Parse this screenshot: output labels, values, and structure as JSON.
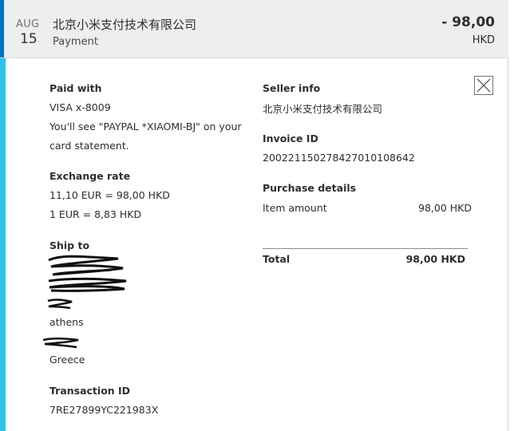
{
  "header": {
    "month": "AUG",
    "day": "15",
    "merchant": "北京小米支付技术有限公司",
    "type": "Payment",
    "amount": "- 98,00",
    "currency": "HKD"
  },
  "paid_with": {
    "label": "Paid with",
    "card": "VISA x-8009",
    "statement_line1": "You'll see \"PAYPAL *XIAOMI-BJ\" on your",
    "statement_line2": "card statement."
  },
  "exchange_rate": {
    "label": "Exchange rate",
    "line1": "11,10 EUR = 98,00 HKD",
    "line2": "1 EUR = 8,83 HKD"
  },
  "ship_to": {
    "label": "Ship to",
    "city": "athens",
    "country": "Greece"
  },
  "transaction": {
    "label": "Transaction ID",
    "id": "7RE27899YC221983X"
  },
  "seller_info": {
    "label": "Seller info",
    "name": "北京小米支付技术有限公司"
  },
  "invoice": {
    "label": "Invoice ID",
    "id": "20022115027842701010864​2"
  },
  "purchase": {
    "label": "Purchase details",
    "item_label": "Item amount",
    "item_value": "98,00 HKD",
    "total_label": "Total",
    "total_value": "98,00 HKD"
  },
  "colors": {
    "header_bg": "#eeeeee",
    "header_accent": "#0070ba",
    "detail_accent": "#2fc1e9"
  }
}
